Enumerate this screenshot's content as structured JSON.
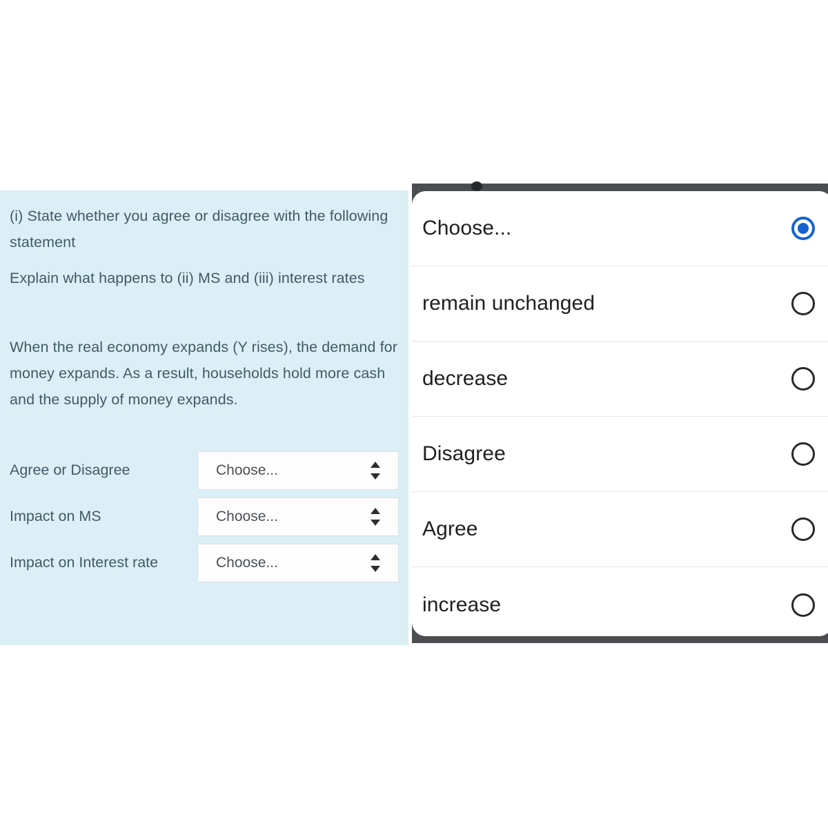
{
  "question": {
    "prompt_line_a": "(i) State whether you agree or disagree with the following statement",
    "prompt_line_b": "Explain what happens to (ii) MS and (iii) interest rates",
    "statement": "When the real economy expands (Y rises), the demand for money expands. As a result, households hold more cash and the supply of money expands.",
    "rows": [
      {
        "label": "Agree or Disagree",
        "value": "Choose..."
      },
      {
        "label": "Impact on MS",
        "value": "Choose..."
      },
      {
        "label": "Impact on Interest rate",
        "value": "Choose..."
      }
    ]
  },
  "picker": {
    "options": [
      {
        "label": "Choose...",
        "selected": true
      },
      {
        "label": "remain unchanged",
        "selected": false
      },
      {
        "label": "decrease",
        "selected": false
      },
      {
        "label": "Disagree",
        "selected": false
      },
      {
        "label": "Agree",
        "selected": false
      },
      {
        "label": "increase",
        "selected": false
      }
    ]
  },
  "colors": {
    "panel_background": "#ddeff6",
    "panel_text": "#3f5a66",
    "sheet_backdrop": "#4c4d50",
    "accent_selected": "#1362cf",
    "radio_outline": "#26282a"
  }
}
